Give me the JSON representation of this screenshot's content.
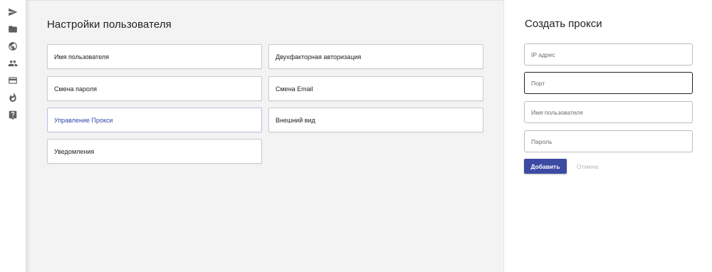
{
  "sidebar": {
    "icons": [
      "send-icon",
      "folder-icon",
      "globe-icon",
      "people-icon",
      "card-icon",
      "fire-icon",
      "help-icon"
    ]
  },
  "settings": {
    "title": "Настройки пользователя",
    "items": [
      {
        "label": "Имя пользователя"
      },
      {
        "label": "Двухфакторная авторизация"
      },
      {
        "label": "Смена пароля"
      },
      {
        "label": "Смена Email"
      },
      {
        "label": "Управление Прокси",
        "active": true
      },
      {
        "label": "Внешний вид"
      },
      {
        "label": "Уведомления"
      }
    ]
  },
  "proxy_form": {
    "title": "Создать прокси",
    "ip_placeholder": "IP адрес",
    "port_placeholder": "Порт",
    "username_placeholder": "Имя пользователя",
    "password_placeholder": "Пароль",
    "add_label": "Добавить",
    "cancel_label": "Отмена"
  },
  "colors": {
    "accent": "#3d4aa3",
    "active_text": "#3547a8",
    "main_bg": "#f3f3f3"
  }
}
